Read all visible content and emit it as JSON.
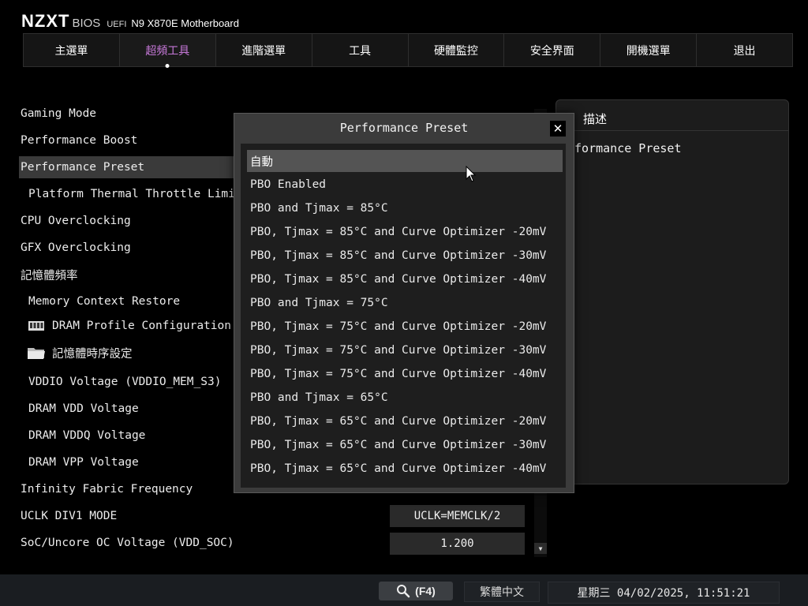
{
  "brand": {
    "logo": "NZXT",
    "bios": "BIOS",
    "uefi": "UEFI",
    "model": "N9 X870E Motherboard"
  },
  "nav": {
    "tabs": [
      "主選單",
      "超頻工具",
      "進階選單",
      "工具",
      "硬體監控",
      "安全界面",
      "開機選單",
      "退出"
    ],
    "active_index": 1
  },
  "settings": [
    {
      "label": "Gaming Mode"
    },
    {
      "label": "Performance Boost"
    },
    {
      "label": "Performance Preset"
    },
    {
      "label": "Platform Thermal Throttle Limit(°"
    },
    {
      "label": "CPU Overclocking"
    },
    {
      "label": "GFX Overclocking"
    },
    {
      "label": "記憶體頻率"
    },
    {
      "label": "Memory Context Restore"
    },
    {
      "label": "DRAM Profile Configuration",
      "icon": "memory-module-icon"
    },
    {
      "label": "記憶體時序設定",
      "icon": "folder-icon"
    },
    {
      "label": "VDDIO Voltage (VDDIO_MEM_S3)"
    },
    {
      "label": "DRAM VDD Voltage"
    },
    {
      "label": "DRAM VDDQ Voltage"
    },
    {
      "label": "DRAM VPP Voltage"
    },
    {
      "label": "Infinity Fabric Frequency"
    },
    {
      "label": "UCLK DIV1 MODE"
    },
    {
      "label": "SoC/Uncore OC Voltage (VDD_SOC)"
    }
  ],
  "values": {
    "uclk_div1_mode": "UCLK=MEMCLK/2",
    "soc_voltage": "1.200"
  },
  "description": {
    "title": "描述",
    "text": "rformance Preset"
  },
  "modal": {
    "title": "Performance Preset",
    "close_glyph": "✕",
    "options": [
      "自動",
      "PBO Enabled",
      "PBO and Tjmax = 85°C",
      "PBO, Tjmax = 85°C and Curve Optimizer -20mV",
      "PBO, Tjmax = 85°C and Curve Optimizer -30mV",
      "PBO, Tjmax = 85°C and Curve Optimizer -40mV",
      "PBO and Tjmax = 75°C",
      "PBO, Tjmax = 75°C and Curve Optimizer -20mV",
      "PBO, Tjmax = 75°C and Curve Optimizer -30mV",
      "PBO, Tjmax = 75°C and Curve Optimizer -40mV",
      "PBO and Tjmax = 65°C",
      "PBO, Tjmax = 65°C and Curve Optimizer -20mV",
      "PBO, Tjmax = 65°C and Curve Optimizer -30mV",
      "PBO, Tjmax = 65°C and Curve Optimizer -40mV"
    ],
    "selected_index": 0
  },
  "bottom": {
    "search_key": "(F4)",
    "language": "繁體中文",
    "datetime": "星期三 04/02/2025, 11:51:21"
  },
  "colors": {
    "accent": "#c678d8",
    "background": "#000000",
    "modal_bg": "#3b3b3b",
    "selected_option_bg": "#545454"
  }
}
